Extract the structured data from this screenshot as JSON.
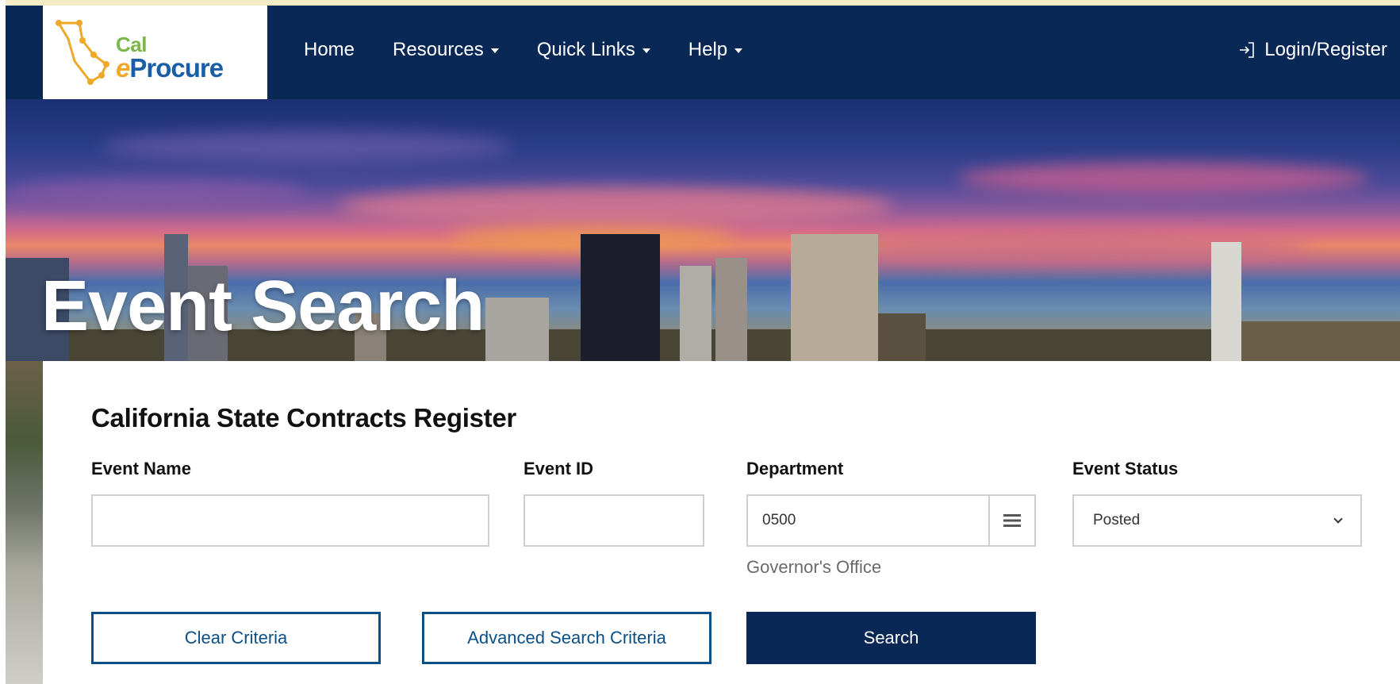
{
  "logo": {
    "cal": "Cal",
    "e": "e",
    "procure": "Procure"
  },
  "nav": {
    "home": "Home",
    "resources": "Resources",
    "quick_links": "Quick Links",
    "help": "Help",
    "login": "Login/Register"
  },
  "hero": {
    "title": "Event Search"
  },
  "search": {
    "section_title": "California State Contracts Register",
    "event_name_label": "Event Name",
    "event_name_value": "",
    "event_id_label": "Event ID",
    "event_id_value": "",
    "department_label": "Department",
    "department_value": "0500",
    "department_name": "Governor's Office",
    "event_status_label": "Event Status",
    "event_status_value": "Posted",
    "clear_button": "Clear Criteria",
    "advanced_button": "Advanced Search Criteria",
    "search_button": "Search"
  },
  "colors": {
    "navy": "#0a2856",
    "outline_blue": "#0a4f86",
    "logo_green": "#7ab648",
    "logo_blue": "#1b5ea8",
    "logo_gold": "#f0a828"
  }
}
